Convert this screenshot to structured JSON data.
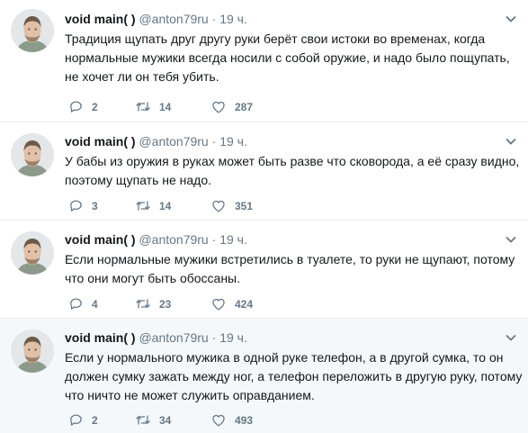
{
  "tweets": [
    {
      "author_name": "void main( )",
      "handle": "@anton79ru",
      "separator": "·",
      "time": "19 ч.",
      "text": "Традиция щупать друг другу руки берёт свои истоки во временах, когда нормальные мужики всегда носили с собой оружие, и надо было пощупать, не хочет ли он тебя убить.",
      "replies": "2",
      "retweets": "14",
      "likes": "287"
    },
    {
      "author_name": "void main( )",
      "handle": "@anton79ru",
      "separator": "·",
      "time": "19 ч.",
      "text": "У бабы из оружия в руках может быть разве что сковорода, а её сразу видно, поэтому щупать не надо.",
      "replies": "3",
      "retweets": "14",
      "likes": "351"
    },
    {
      "author_name": "void main( )",
      "handle": "@anton79ru",
      "separator": "·",
      "time": "19 ч.",
      "text": "Если нормальные мужики встретились в туалете, то руки не щупают, потому что они могут быть обоссаны.",
      "replies": "4",
      "retweets": "23",
      "likes": "424"
    },
    {
      "author_name": "void main( )",
      "handle": "@anton79ru",
      "separator": "·",
      "time": "19 ч.",
      "text": "Если у нормального мужика в одной руке телефон, а в другой сумка, то он должен сумку зажать между ног, а телефон переложить в другую руку, потому что ничто не может служить оправданием.",
      "replies": "2",
      "retweets": "34",
      "likes": "493"
    }
  ],
  "icons": {
    "reply": "reply-icon",
    "retweet": "retweet-icon",
    "like": "like-icon",
    "menu": "chevron-down-icon"
  },
  "colors": {
    "text": "#14171a",
    "secondary": "#657786",
    "divider": "#e6ecf0",
    "highlight_bg": "#f5f8fa"
  }
}
